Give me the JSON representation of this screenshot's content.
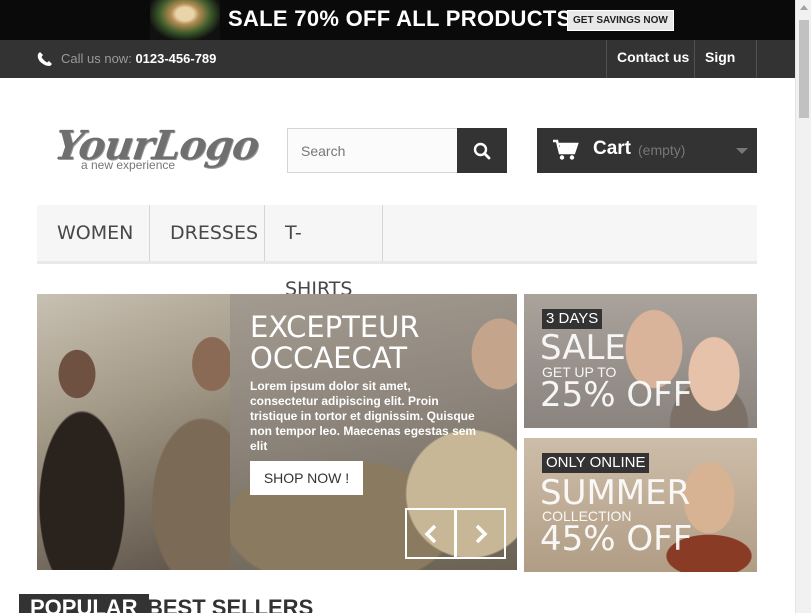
{
  "promo": {
    "text": "SALE 70% OFF ALL PRODUCTS",
    "button": "GET SAVINGS NOW"
  },
  "topbar": {
    "call_label": "Call us now:",
    "phone": "0123-456-789",
    "contact": "Contact us",
    "signin": "Sign in"
  },
  "header": {
    "logo_main": "YourLogo",
    "logo_sub": "a new experience",
    "search_placeholder": "Search",
    "cart_label": "Cart",
    "cart_status": "(empty)"
  },
  "menu": {
    "items": [
      "WOMEN",
      "DRESSES",
      "T-SHIRTS"
    ]
  },
  "hero": {
    "title": "EXCEPTEUR OCCAECAT",
    "text": "Lorem ipsum dolor sit amet, consectetur adipiscing elit. Proin tristique in tortor et dignissim. Quisque non tempor leo. Maecenas egestas sem elit",
    "button": "SHOP NOW !"
  },
  "banners": [
    {
      "tag": "3 DAYS",
      "big1": "SALE",
      "small1": "GET UP TO",
      "big2": "25% OFF"
    },
    {
      "tag": "ONLY ONLINE",
      "big1": "SUMMER",
      "small1": "COLLECTION",
      "big2": "45% OFF"
    }
  ],
  "tabs": [
    "POPULAR",
    "BEST SELLERS"
  ],
  "colors": {
    "dark": "#333333",
    "menu_bg": "#f6f6f6",
    "border": "#d6d4d4"
  }
}
